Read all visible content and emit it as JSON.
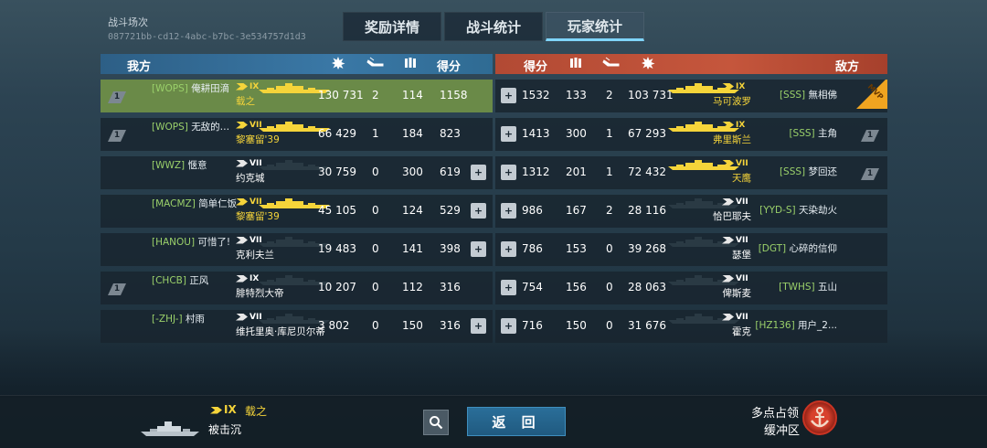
{
  "header": {
    "title": "战斗场次",
    "battle_id": "087721bb-cd12-4abc-b7bc-3e534757d1d3"
  },
  "tabs": [
    "奖励详情",
    "战斗统计",
    "玩家统计"
  ],
  "left": {
    "team_label": "我方",
    "score_label": "得分",
    "rows": [
      {
        "rank": "1",
        "clan": "[WOPS]",
        "name": "俺耕田滴",
        "tier": "IX",
        "ship": "载之",
        "damage": "130 731",
        "kills": "2",
        "xp": "114",
        "score": "1158",
        "gold": true,
        "highlight": true,
        "add": false
      },
      {
        "rank": "1",
        "clan": "[WOPS]",
        "name": "无敌的…",
        "tier": "VII",
        "ship": "黎塞留'39",
        "damage": "66 429",
        "kills": "1",
        "xp": "184",
        "score": "823",
        "gold": true,
        "add": false
      },
      {
        "rank": "",
        "clan": "[WWZ]",
        "name": "惬意",
        "tier": "VII",
        "ship": "约克城",
        "damage": "30 759",
        "kills": "0",
        "xp": "300",
        "score": "619",
        "gold": false,
        "add": true
      },
      {
        "rank": "",
        "clan": "[MACMZ]",
        "name": "简单仁饭",
        "tier": "VII",
        "ship": "黎塞留'39",
        "damage": "45 105",
        "kills": "0",
        "xp": "124",
        "score": "529",
        "gold": true,
        "add": true
      },
      {
        "rank": "",
        "clan": "[HANOU]",
        "name": "可惜了!",
        "tier": "VII",
        "ship": "克利夫兰",
        "damage": "19 483",
        "kills": "0",
        "xp": "141",
        "score": "398",
        "gold": false,
        "add": true
      },
      {
        "rank": "1",
        "clan": "[CHCB]",
        "name": "正风",
        "tier": "IX",
        "ship": "腓特烈大帝",
        "damage": "10 207",
        "kills": "0",
        "xp": "112",
        "score": "316",
        "gold": false,
        "add": false
      },
      {
        "rank": "",
        "clan": "[-ZHJ-]",
        "name": "村雨",
        "tier": "VII",
        "ship": "维托里奥·库尼贝尔蒂",
        "damage": "3 802",
        "kills": "0",
        "xp": "150",
        "score": "316",
        "gold": false,
        "add": true
      }
    ]
  },
  "right": {
    "team_label": "敌方",
    "score_label": "得分",
    "rows": [
      {
        "rank": "",
        "clan": "[SSS]",
        "name": "無相佛",
        "tier": "IX",
        "ship": "马可波罗",
        "damage": "103 731",
        "kills": "2",
        "xp": "133",
        "score": "1532",
        "gold": true,
        "mvp": true
      },
      {
        "rank": "1",
        "clan": "[SSS]",
        "name": "主角",
        "tier": "IX",
        "ship": "弗里斯兰",
        "damage": "67 293",
        "kills": "1",
        "xp": "300",
        "score": "1413",
        "gold": true
      },
      {
        "rank": "1",
        "clan": "[SSS]",
        "name": "梦回还",
        "tier": "VII",
        "ship": "天鹰",
        "damage": "72 432",
        "kills": "1",
        "xp": "201",
        "score": "1312",
        "gold": true
      },
      {
        "rank": "",
        "clan": "[YYD-S]",
        "name": "天染劫火",
        "tier": "VII",
        "ship": "恰巴耶夫",
        "damage": "28 116",
        "kills": "2",
        "xp": "167",
        "score": "986",
        "gold": false
      },
      {
        "rank": "",
        "clan": "[DGT]",
        "name": "心碎的信仰",
        "tier": "VII",
        "ship": "瑟堡",
        "damage": "39 268",
        "kills": "0",
        "xp": "153",
        "score": "786",
        "gold": false
      },
      {
        "rank": "",
        "clan": "[TWHS]",
        "name": "五山",
        "tier": "VII",
        "ship": "俾斯麦",
        "damage": "28 063",
        "kills": "0",
        "xp": "156",
        "score": "754",
        "gold": false
      },
      {
        "rank": "",
        "clan": "[HZ136]",
        "name": "用户_2...",
        "tier": "VII",
        "ship": "霍克",
        "damage": "31 676",
        "kills": "0",
        "xp": "150",
        "score": "716",
        "gold": false
      }
    ]
  },
  "mvp_label": "MVP",
  "bottom": {
    "self_tier": "IX",
    "self_ship": "载之",
    "self_status": "被击沉",
    "back_label": "返 回",
    "mode_line1": "多点占领",
    "mode_line2": "缓冲区"
  }
}
